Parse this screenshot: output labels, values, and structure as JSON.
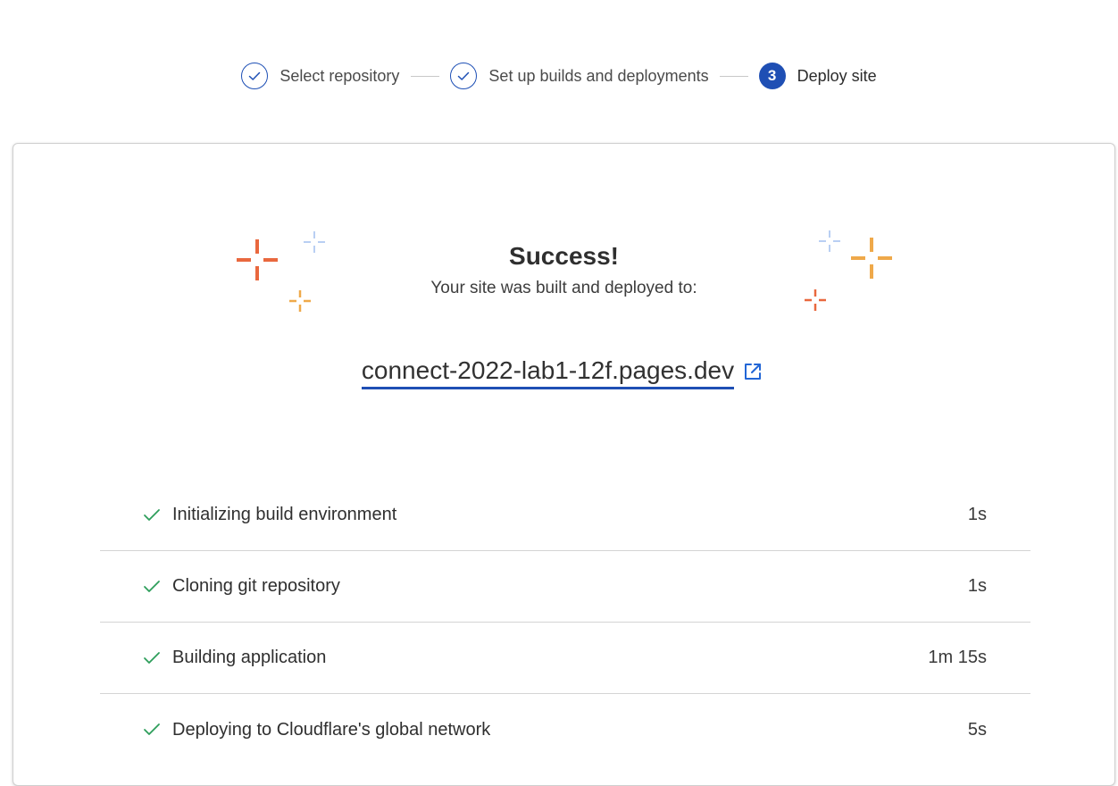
{
  "stepper": {
    "steps": [
      {
        "label": "Select repository",
        "state": "complete"
      },
      {
        "label": "Set up builds and deployments",
        "state": "complete"
      },
      {
        "label": "Deploy site",
        "state": "active",
        "number": "3"
      }
    ]
  },
  "result": {
    "title": "Success!",
    "subtitle": "Your site was built and deployed to:",
    "site_url": "connect-2022-lab1-12f.pages.dev",
    "link_icon": "external-link-icon"
  },
  "build_log": [
    {
      "label": "Initializing build environment",
      "duration": "1s",
      "status": "success"
    },
    {
      "label": "Cloning git repository",
      "duration": "1s",
      "status": "success"
    },
    {
      "label": "Building application",
      "duration": "1m 15s",
      "status": "success"
    },
    {
      "label": "Deploying to Cloudflare's global network",
      "duration": "5s",
      "status": "success"
    }
  ],
  "colors": {
    "accent_blue": "#1f4fb4",
    "success_green": "#2e9e5b",
    "sparkle_orange": "#e9683e",
    "sparkle_yellow": "#efa94a",
    "sparkle_light_blue": "#b9cff3"
  }
}
